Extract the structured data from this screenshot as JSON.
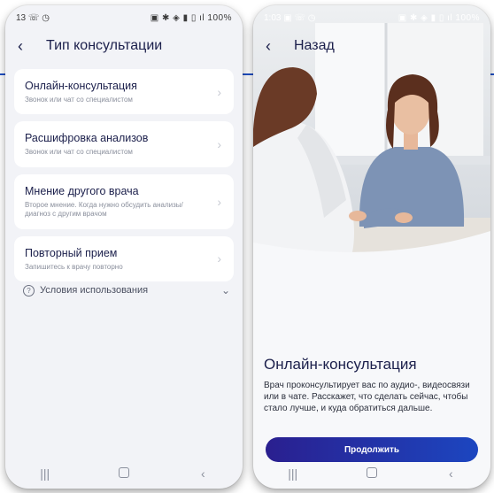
{
  "left_screen": {
    "status": {
      "time": "13",
      "icons": "☏ ◷",
      "indicators": "▣ ✱ ◈ ▮ ▯ ıl 100%"
    },
    "nav": {
      "back": "‹",
      "title": "Тип консультации"
    },
    "items": [
      {
        "title": "Онлайн-консультация",
        "subtitle": "Звонок или чат со специалистом"
      },
      {
        "title": "Расшифровка анализов",
        "subtitle": "Звонок или чат со специалистом"
      },
      {
        "title": "Мнение другого врача",
        "subtitle": "Второе мнение. Когда нужно обсудить анализы/диагноз с другим врачом"
      },
      {
        "title": "Повторный прием",
        "subtitle": "Запишитесь к врачу повторно"
      }
    ],
    "terms": {
      "label": "Условия использования",
      "icon": "?"
    }
  },
  "right_screen": {
    "status": {
      "time": "1:03",
      "icons": "▣ ☏ ◷",
      "indicators": "▣ ✱ ◈ ▮ ▯ ıl 100%"
    },
    "nav": {
      "back": "‹",
      "title": "Назад"
    },
    "content": {
      "title": "Онлайн-консультация",
      "text": "Врач проконсультирует вас по аудио-, видеосвязи или в чате. Расскажет, что сделать сейчас, чтобы стало лучше, и куда обратиться дальше."
    },
    "cta_label": "Продолжить"
  },
  "system_nav": {
    "recents": "|||",
    "home": "",
    "back": "‹"
  },
  "colors": {
    "accent": "#1f4fc4",
    "text_dark": "#1b1f4b",
    "button_start": "#2a1f8f",
    "button_end": "#1c46c0"
  }
}
